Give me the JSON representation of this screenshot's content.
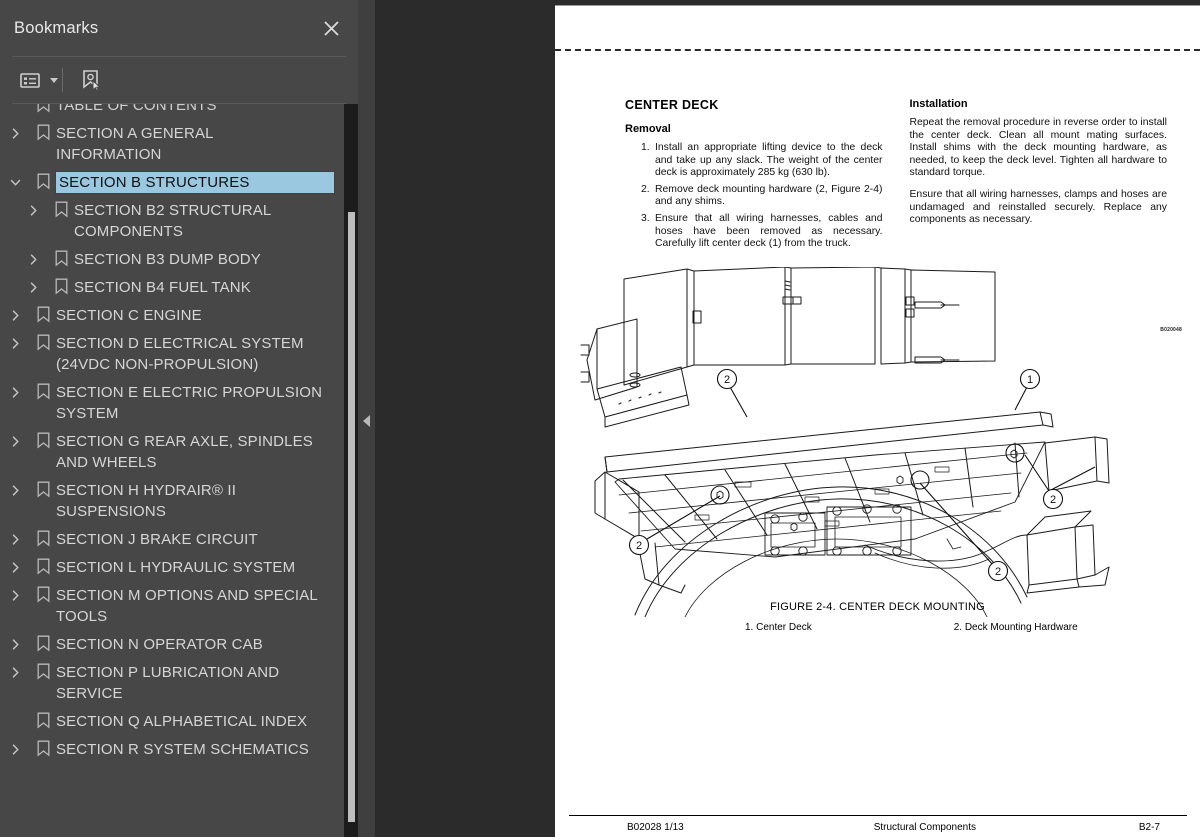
{
  "sidebar": {
    "title": "Bookmarks",
    "close_icon": "close-icon",
    "toolbar": {
      "options_icon": "list-options-icon",
      "caret_icon": "chevron-down-icon",
      "new_bookmark_icon": "new-bookmark-icon"
    },
    "items": [
      {
        "label": "TABLE OF CONTENTS",
        "level": 1,
        "twisty": "none",
        "selected": false,
        "partial": true
      },
      {
        "label": "SECTION A GENERAL INFORMATION",
        "level": 1,
        "twisty": "collapsed",
        "selected": false,
        "partial": false
      },
      {
        "label": "SECTION B STRUCTURES",
        "level": 1,
        "twisty": "expanded",
        "selected": true,
        "partial": false
      },
      {
        "label": "SECTION B2 STRUCTURAL COMPONENTS",
        "level": 2,
        "twisty": "collapsed",
        "selected": false,
        "partial": false
      },
      {
        "label": "SECTION B3 DUMP BODY",
        "level": 2,
        "twisty": "collapsed",
        "selected": false,
        "partial": false
      },
      {
        "label": "SECTION B4 FUEL TANK",
        "level": 2,
        "twisty": "collapsed",
        "selected": false,
        "partial": false
      },
      {
        "label": "SECTION C ENGINE",
        "level": 1,
        "twisty": "collapsed",
        "selected": false,
        "partial": false
      },
      {
        "label": "SECTION D ELECTRICAL SYSTEM (24VDC NON-PROPULSION)",
        "level": 1,
        "twisty": "collapsed",
        "selected": false,
        "partial": false
      },
      {
        "label": "SECTION E ELECTRIC PROPULSION SYSTEM",
        "level": 1,
        "twisty": "collapsed",
        "selected": false,
        "partial": false
      },
      {
        "label": "SECTION G REAR AXLE, SPINDLES AND WHEELS",
        "level": 1,
        "twisty": "collapsed",
        "selected": false,
        "partial": false
      },
      {
        "label": "SECTION H HYDRAIR® II SUSPENSIONS",
        "level": 1,
        "twisty": "collapsed",
        "selected": false,
        "partial": false
      },
      {
        "label": "SECTION J BRAKE CIRCUIT",
        "level": 1,
        "twisty": "collapsed",
        "selected": false,
        "partial": false
      },
      {
        "label": "SECTION L HYDRAULIC SYSTEM",
        "level": 1,
        "twisty": "collapsed",
        "selected": false,
        "partial": false
      },
      {
        "label": "SECTION M OPTIONS AND SPECIAL TOOLS",
        "level": 1,
        "twisty": "collapsed",
        "selected": false,
        "partial": false
      },
      {
        "label": "SECTION N OPERATOR CAB",
        "level": 1,
        "twisty": "collapsed",
        "selected": false,
        "partial": false
      },
      {
        "label": "SECTION P LUBRICATION AND SERVICE",
        "level": 1,
        "twisty": "collapsed",
        "selected": false,
        "partial": false
      },
      {
        "label": "SECTION Q ALPHABETICAL INDEX",
        "level": 1,
        "twisty": "none",
        "selected": false,
        "partial": false
      },
      {
        "label": "SECTION R SYSTEM SCHEMATICS",
        "level": 1,
        "twisty": "collapsed",
        "selected": false,
        "partial": false
      }
    ],
    "colors": {
      "panel_bg": "#474747",
      "selection_bg": "#9ac8e0",
      "label_text": "#d6d6d6",
      "scrollbar_track": "#1c1c1c",
      "scrollbar_thumb": "#bdbdbd"
    }
  },
  "viewer": {
    "collapse_handle_icon": "collapse-left-icon",
    "background": "#2b2b2b"
  },
  "document": {
    "left_column": {
      "title": "CENTER DECK",
      "subtitle": "Removal",
      "steps": [
        "Install an appropriate lifting device to the deck and take up any slack. The weight of the center deck is approximately 285 kg (630 lb).",
        "Remove deck mounting hardware (2, Figure 2-4) and any shims.",
        "Ensure that all wiring harnesses, cables and hoses have been removed as necessary. Carefully lift center deck (1) from the truck."
      ]
    },
    "right_column": {
      "subtitle": "Installation",
      "paragraphs": [
        "Repeat the removal procedure in reverse order to install the center deck. Clean all mount mating surfaces. Install shims with the deck mounting hardware, as needed, to keep the deck level. Tighten all hardware to standard torque.",
        "Ensure that all wiring harnesses, clamps and hoses are undamaged and reinstalled securely. Replace any components as necessary."
      ]
    },
    "figure": {
      "drawing_ref": "B020048",
      "caption": "FIGURE 2-4. CENTER DECK MOUNTING",
      "legend": [
        "1. Center Deck",
        "2. Deck Mounting Hardware"
      ],
      "callouts": [
        "1",
        "2",
        "2",
        "2",
        "2"
      ]
    },
    "footer": {
      "left": "B02028   1/13",
      "center": "Structural Components",
      "right": "B2-7"
    }
  }
}
